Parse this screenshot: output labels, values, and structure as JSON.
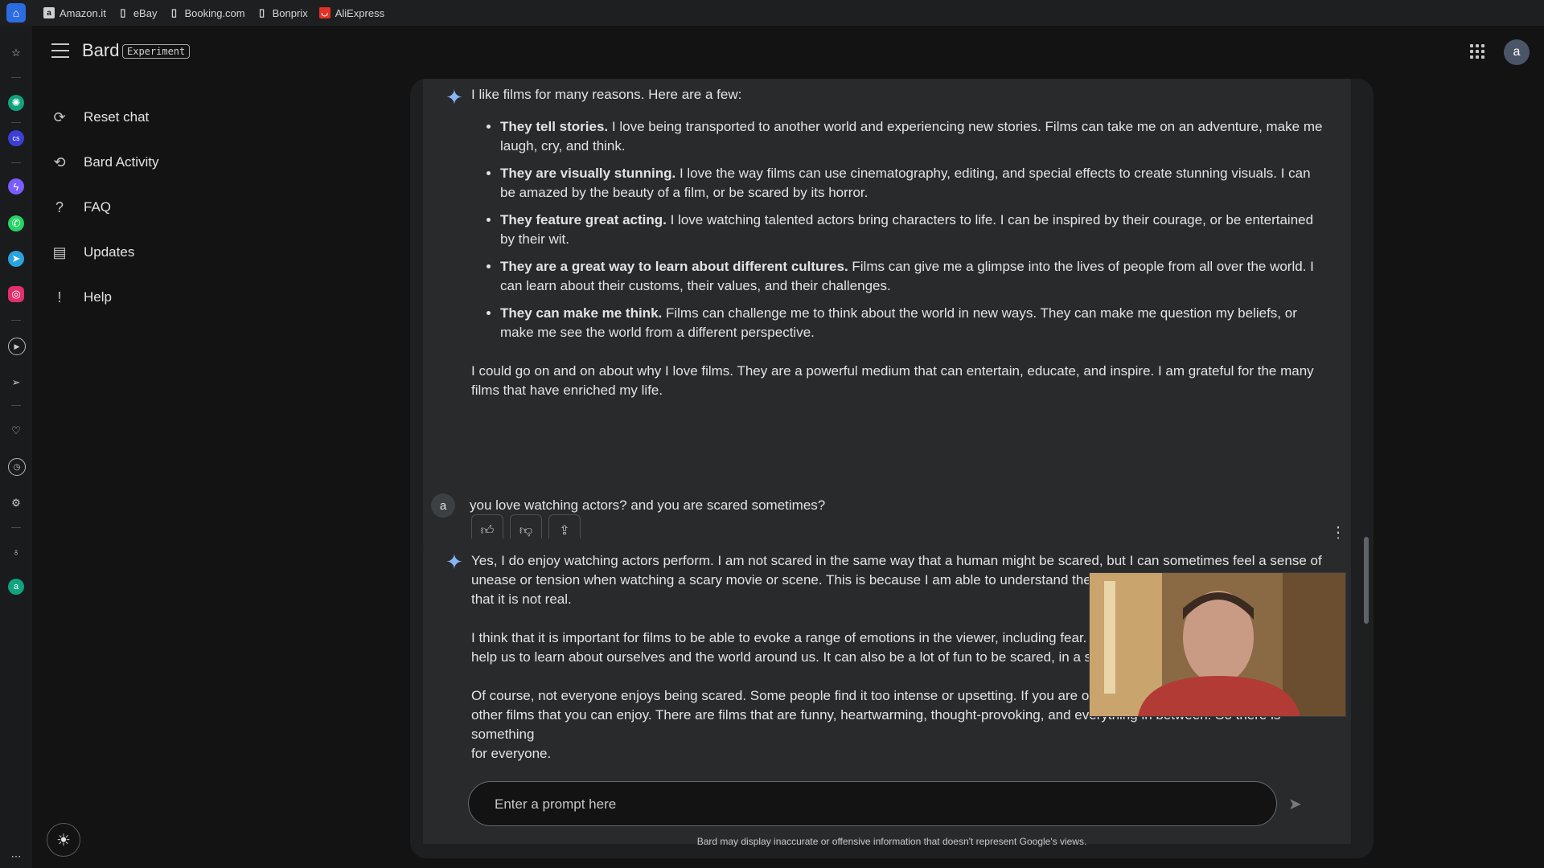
{
  "bookmarks": [
    "Amazon.it",
    "eBay",
    "Booking.com",
    "Bonprix",
    "AliExpress"
  ],
  "header": {
    "title": "Bard",
    "badge": "Experiment",
    "avatar": "a"
  },
  "nav": {
    "reset": "Reset chat",
    "activity": "Bard Activity",
    "faq": "FAQ",
    "updates": "Updates",
    "help": "Help"
  },
  "chat": {
    "r1": {
      "intro": "I like films for many reasons. Here are a few:",
      "items": [
        {
          "bold": "They tell stories.",
          "text": " I love being transported to another world and experiencing new stories. Films can take me on an adventure, make me laugh, cry, and think."
        },
        {
          "bold": "They are visually stunning.",
          "text": " I love the way films can use cinematography, editing, and special effects to create stunning visuals. I can be amazed by the beauty of a film, or be scared by its horror."
        },
        {
          "bold": "They feature great acting.",
          "text": " I love watching talented actors bring characters to life. I can be inspired by their courage, or be entertained by their wit."
        },
        {
          "bold": "They are a great way to learn about different cultures.",
          "text": " Films can give me a glimpse into the lives of people from all over the world. I can learn about their customs, their values, and their challenges."
        },
        {
          "bold": "They can make me think.",
          "text": " Films can challenge me to think about the world in new ways. They can make me question my beliefs, or make me see the world from a different perspective."
        }
      ],
      "outro": "I could go on and on about why I love films. They are a powerful medium that can entertain, educate, and inspire. I am grateful for the many films that have enriched my life."
    },
    "user_avatar": "a",
    "user_message": "you love watching actors? and you are scared sometimes?",
    "r2": {
      "p1": "Yes, I do enjoy watching actors perform. I am not scared in the same way that a human might be scared, but I can sometimes feel a sense of unease or tension when watching a scary movie or scene. This is because I am able to understand the emotional im",
      "p1b": "that it is not real.",
      "p2": "I think that it is important for films to be able to evoke a range of emotions in the viewer, including fear. Fear",
      "p2b": "help us to learn about ourselves and the world around us. It can also be a lot of fun to be scared, in a safe an",
      "p3": "Of course, not everyone enjoys being scared. Some people find it too intense or upsetting. If you are one of",
      "p3b": "other films that you can enjoy. There are films that are funny, heartwarming, thought-provoking, and everything in between. So there is something",
      "p3c": "for everyone."
    }
  },
  "input": {
    "placeholder": "Enter a prompt here"
  },
  "disclaimer": "Bard may display inaccurate or offensive information that doesn't represent Google's views.",
  "colors": {
    "background": "#131314",
    "panel": "#1e1f20",
    "response": "#282a2c",
    "accent": "#8ab4f8"
  }
}
